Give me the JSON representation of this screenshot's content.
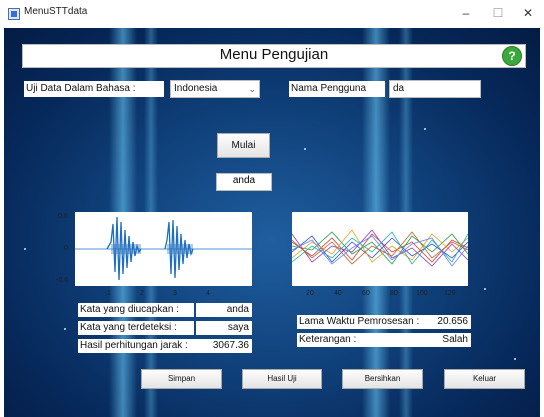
{
  "window": {
    "title": "MenuSTTdata"
  },
  "header": {
    "title": "Menu Pengujian",
    "help_glyph": "?"
  },
  "language": {
    "label": "Uji Data Dalam Bahasa :",
    "selected": "Indonesia"
  },
  "user": {
    "label": "Nama Pengguna",
    "value": "da"
  },
  "start_button": "Mulai",
  "result_word": "anda",
  "waveform": {
    "yticks": [
      "0.6",
      "0",
      "-0.6"
    ],
    "xticks": [
      "1",
      "2",
      "3",
      "4"
    ]
  },
  "feature_plot": {
    "xticks": [
      "0",
      "20",
      "40",
      "60",
      "80",
      "100",
      "120"
    ]
  },
  "details": {
    "spoken_label": "Kata yang diucapkan :",
    "spoken_value": "anda",
    "detected_label": "Kata yang terdeteksi :",
    "detected_value": "saya",
    "distance_label": "Hasil perhitungan jarak :",
    "distance_value": "3067.36"
  },
  "process": {
    "time_label": "Lama Waktu Pemrosesan :",
    "time_value": "20.656",
    "status_label": "Keterangan :",
    "status_value": "Salah"
  },
  "buttons": {
    "save": "Simpan",
    "results": "Hasil Uji",
    "clear": "Bersihkan",
    "exit": "Keluar"
  },
  "colors": {
    "background": "#0f3f78",
    "glow": "#6ed2ff",
    "waveform": "#1f6fc0",
    "help": "#3aa83a"
  }
}
